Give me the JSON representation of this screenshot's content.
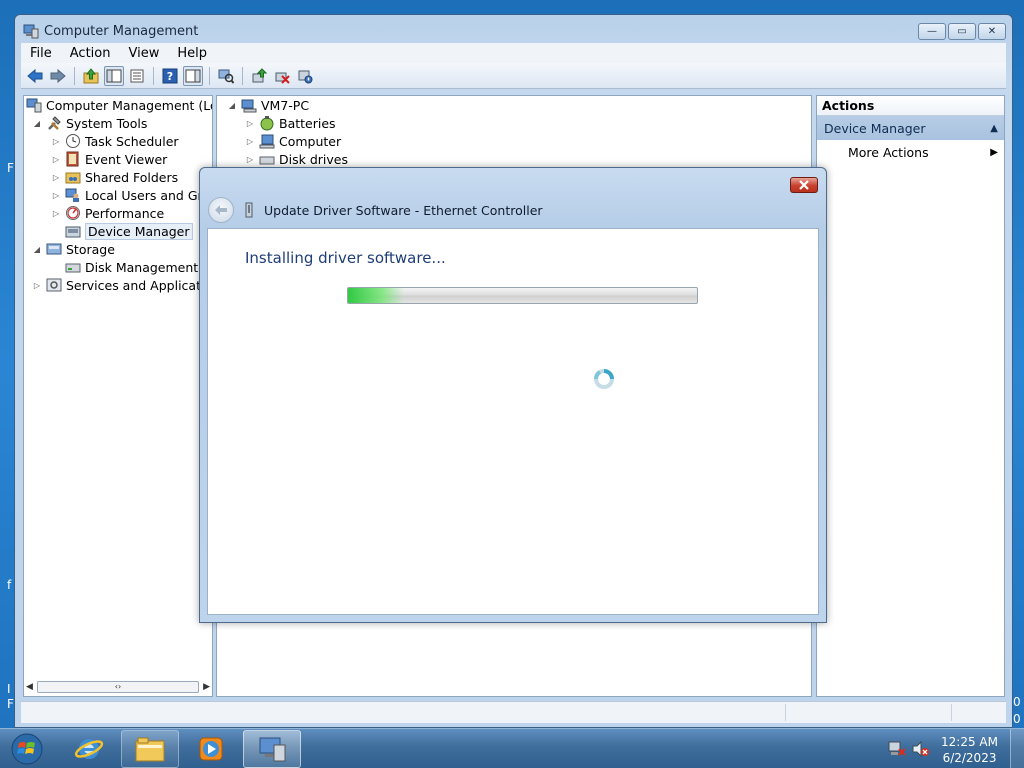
{
  "window": {
    "title": "Computer Management",
    "caption": {
      "minimize": "—",
      "maximize": "▭",
      "close": "✕"
    }
  },
  "menubar": [
    "File",
    "Action",
    "View",
    "Help"
  ],
  "toolbar_icons": [
    "back-icon",
    "forward-icon",
    "up-folder-icon",
    "show-hide-tree-icon",
    "properties-icon",
    "help-icon",
    "action-pane-icon",
    "scan-hardware-icon",
    "update-driver-icon",
    "uninstall-icon",
    "disable-device-icon"
  ],
  "left_tree": {
    "root": "Computer Management (Local",
    "items": [
      {
        "label": "System Tools",
        "icon": "tools-icon"
      },
      {
        "label": "Task Scheduler",
        "icon": "clock-icon"
      },
      {
        "label": "Event Viewer",
        "icon": "event-viewer-icon"
      },
      {
        "label": "Shared Folders",
        "icon": "shared-folders-icon"
      },
      {
        "label": "Local Users and Group",
        "icon": "users-icon"
      },
      {
        "label": "Performance",
        "icon": "performance-icon"
      },
      {
        "label": "Device Manager",
        "icon": "device-manager-icon"
      },
      {
        "label": "Storage",
        "icon": "storage-icon"
      },
      {
        "label": "Disk Management",
        "icon": "disk-icon"
      },
      {
        "label": "Services and Applications",
        "icon": "services-icon"
      }
    ],
    "scroll_thumb": "‹›"
  },
  "device_tree": {
    "root": "VM7-PC",
    "items": [
      "Batteries",
      "Computer",
      "Disk drives"
    ]
  },
  "actions": {
    "header": "Actions",
    "section": "Device Manager",
    "items": [
      "More Actions"
    ]
  },
  "dialog": {
    "title": "Update Driver Software - Ethernet Controller",
    "heading": "Installing driver software...",
    "progress": 0.16
  },
  "taskbar": {
    "apps": [
      "internet-explorer-icon",
      "explorer-icon",
      "media-player-icon",
      "computer-management-icon"
    ],
    "time": "12:25 AM",
    "date": "6/2/2023"
  },
  "desktop_edge_text": [
    "F",
    "f",
    "I",
    "F",
    "0",
    "0"
  ]
}
